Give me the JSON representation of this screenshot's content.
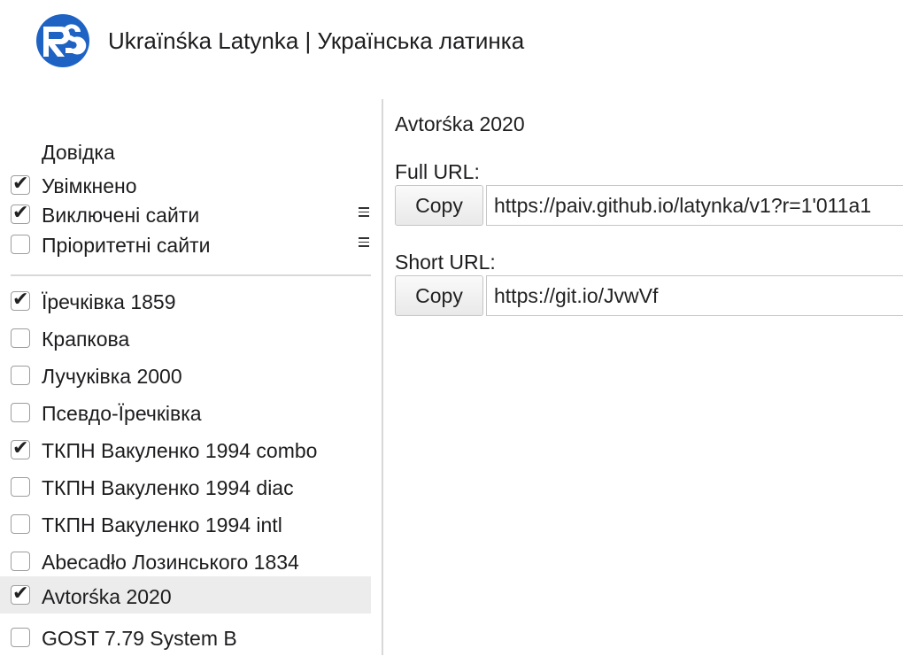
{
  "header": {
    "title": "Ukraïnśka Latynka | Українська латинка",
    "logo": "rs-logo",
    "brand_color": "#1e63c4"
  },
  "sidebar": {
    "help_label": "Довідка",
    "settings": [
      {
        "label": "Увімкнено",
        "checked": true,
        "menu": false
      },
      {
        "label": "Виключені сайти",
        "checked": true,
        "menu": true
      },
      {
        "label": "Пріоритетні сайти",
        "checked": false,
        "menu": true
      }
    ],
    "schemes": [
      {
        "label": "Їречківка 1859",
        "checked": true,
        "selected": false
      },
      {
        "label": "Крапкова",
        "checked": false,
        "selected": false
      },
      {
        "label": "Лучуківка 2000",
        "checked": false,
        "selected": false
      },
      {
        "label": "Псевдо-Їречківка",
        "checked": false,
        "selected": false
      },
      {
        "label": "ТКПН Вакуленко 1994 combo",
        "checked": true,
        "selected": false
      },
      {
        "label": "ТКПН Вакуленко 1994 diac",
        "checked": false,
        "selected": false
      },
      {
        "label": "ТКПН Вакуленко 1994 intl",
        "checked": false,
        "selected": false
      },
      {
        "label": "Abecadło Лозинського 1834",
        "checked": false,
        "selected": false
      },
      {
        "label": "Avtorśka 2020",
        "checked": true,
        "selected": true
      },
      {
        "label": "GOST 7.79 System B",
        "checked": false,
        "selected": false
      }
    ]
  },
  "main": {
    "title": "Avtorśka 2020",
    "full_url": {
      "label": "Full URL:",
      "button": "Copy",
      "value": "https://paiv.github.io/latynka/v1?r=1'011a1"
    },
    "short_url": {
      "label": "Short URL:",
      "button": "Copy",
      "value": "https://git.io/JvwVf"
    }
  }
}
